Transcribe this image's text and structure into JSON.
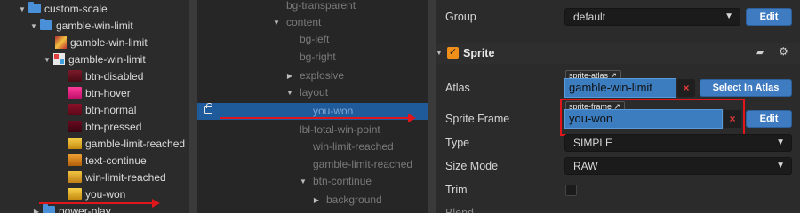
{
  "assets": {
    "items": [
      {
        "label": "custom-scale",
        "icon": "folder-icon"
      },
      {
        "label": "gamble-win-limit",
        "icon": "folder-icon"
      },
      {
        "label": "gamble-win-limit",
        "icon": "atlas-icon"
      },
      {
        "label": "gamble-win-limit",
        "icon": "plist-icon"
      },
      {
        "label": "btn-disabled",
        "icon": "sprite-icon"
      },
      {
        "label": "btn-hover",
        "icon": "sprite-icon"
      },
      {
        "label": "btn-normal",
        "icon": "sprite-icon"
      },
      {
        "label": "btn-pressed",
        "icon": "sprite-icon"
      },
      {
        "label": "gamble-limit-reached",
        "icon": "sprite-icon"
      },
      {
        "label": "text-continue",
        "icon": "sprite-icon"
      },
      {
        "label": "win-limit-reached",
        "icon": "sprite-icon"
      },
      {
        "label": "you-won",
        "icon": "sprite-icon"
      },
      {
        "label": "power-play",
        "icon": "folder-icon"
      }
    ]
  },
  "hierarchy": {
    "nodes": [
      {
        "label": "bg-transparent"
      },
      {
        "label": "content"
      },
      {
        "label": "bg-left"
      },
      {
        "label": "bg-right"
      },
      {
        "label": "explosive"
      },
      {
        "label": "layout"
      },
      {
        "label": "you-won",
        "selected": true
      },
      {
        "label": "lbl-total-win-point"
      },
      {
        "label": "win-limit-reached"
      },
      {
        "label": "gamble-limit-reached"
      },
      {
        "label": "btn-continue"
      },
      {
        "label": "background"
      }
    ]
  },
  "inspector": {
    "group": {
      "label": "Group",
      "value": "default",
      "edit_label": "Edit"
    },
    "sprite_section": {
      "title": "Sprite",
      "enabled": true
    },
    "atlas": {
      "label": "Atlas",
      "tag": "sprite-atlas",
      "value": "gamble-win-limit",
      "clear": "×",
      "select_label": "Select In Atlas"
    },
    "sprite_frame": {
      "label": "Sprite Frame",
      "tag": "sprite-frame",
      "value": "you-won",
      "clear": "×",
      "edit_label": "Edit"
    },
    "type": {
      "label": "Type",
      "value": "SIMPLE"
    },
    "size_mode": {
      "label": "Size Mode",
      "value": "RAW"
    },
    "trim": {
      "label": "Trim",
      "checked": false
    },
    "blend": {
      "label": "Blend"
    }
  },
  "colors": {
    "selection": "#1f5a9a",
    "accent_button": "#3f7bc1",
    "annotation": "#e0161c",
    "checkbox_on": "#ef8f1a"
  }
}
